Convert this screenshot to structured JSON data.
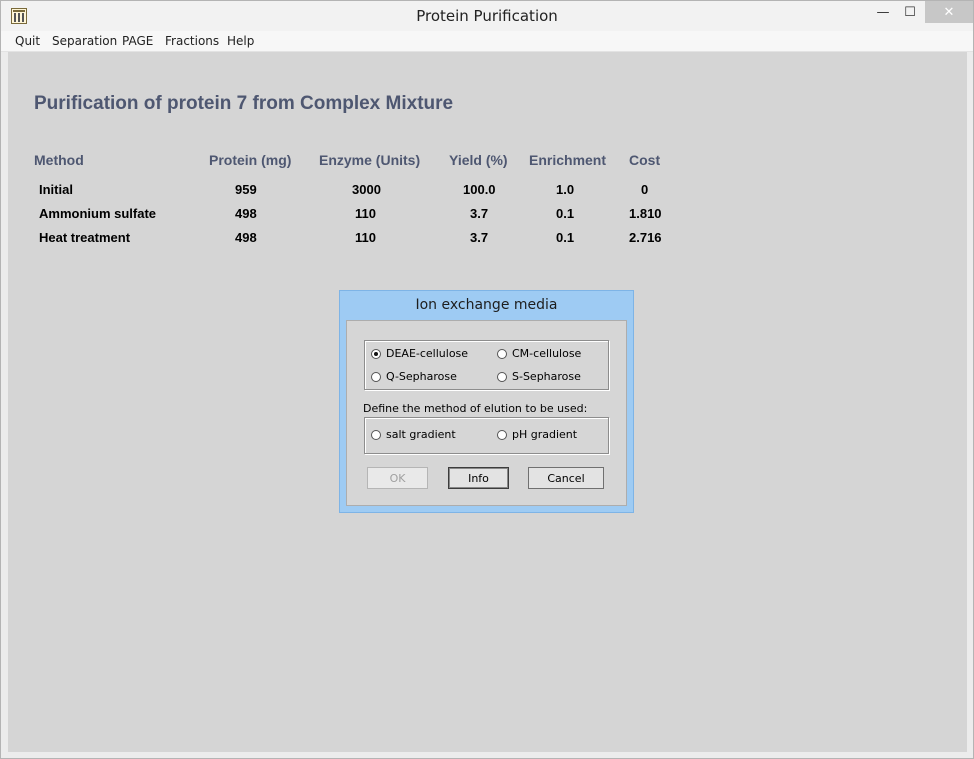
{
  "window": {
    "title": "Protein Purification",
    "controls": {
      "minimize": "—",
      "maximize": "☐",
      "close": "✕"
    }
  },
  "menu": [
    "Quit",
    "Separation",
    "PAGE",
    "Fractions",
    "Help"
  ],
  "main": {
    "heading": "Purification of protein 7 from Complex Mixture",
    "table": {
      "columns": [
        "Method",
        "Protein (mg)",
        "Enzyme (Units)",
        "Yield (%)",
        "Enrichment",
        "Cost"
      ],
      "rows": [
        [
          "Initial",
          "959",
          "3000",
          "100.0",
          "1.0",
          "0"
        ],
        [
          "Ammonium sulfate",
          "498",
          "110",
          "3.7",
          "0.1",
          "1.810"
        ],
        [
          "Heat treatment",
          "498",
          "110",
          "3.7",
          "0.1",
          "2.716"
        ]
      ]
    }
  },
  "dialog": {
    "title": "Ion exchange media",
    "media_options": [
      {
        "label": "DEAE-cellulose",
        "checked": true
      },
      {
        "label": "CM-cellulose",
        "checked": false
      },
      {
        "label": "Q-Sepharose",
        "checked": false
      },
      {
        "label": "S-Sepharose",
        "checked": false
      }
    ],
    "elution_prompt": "Define the method of elution to be used:",
    "elution_options": [
      {
        "label": "salt gradient",
        "checked": false
      },
      {
        "label": "pH gradient",
        "checked": false
      }
    ],
    "buttons": {
      "ok": "OK",
      "info": "Info",
      "cancel": "Cancel"
    }
  },
  "colors": {
    "dialog_frame": "#9ecbf3",
    "heading": "#4e5771",
    "content_bg": "#d5d5d5"
  }
}
